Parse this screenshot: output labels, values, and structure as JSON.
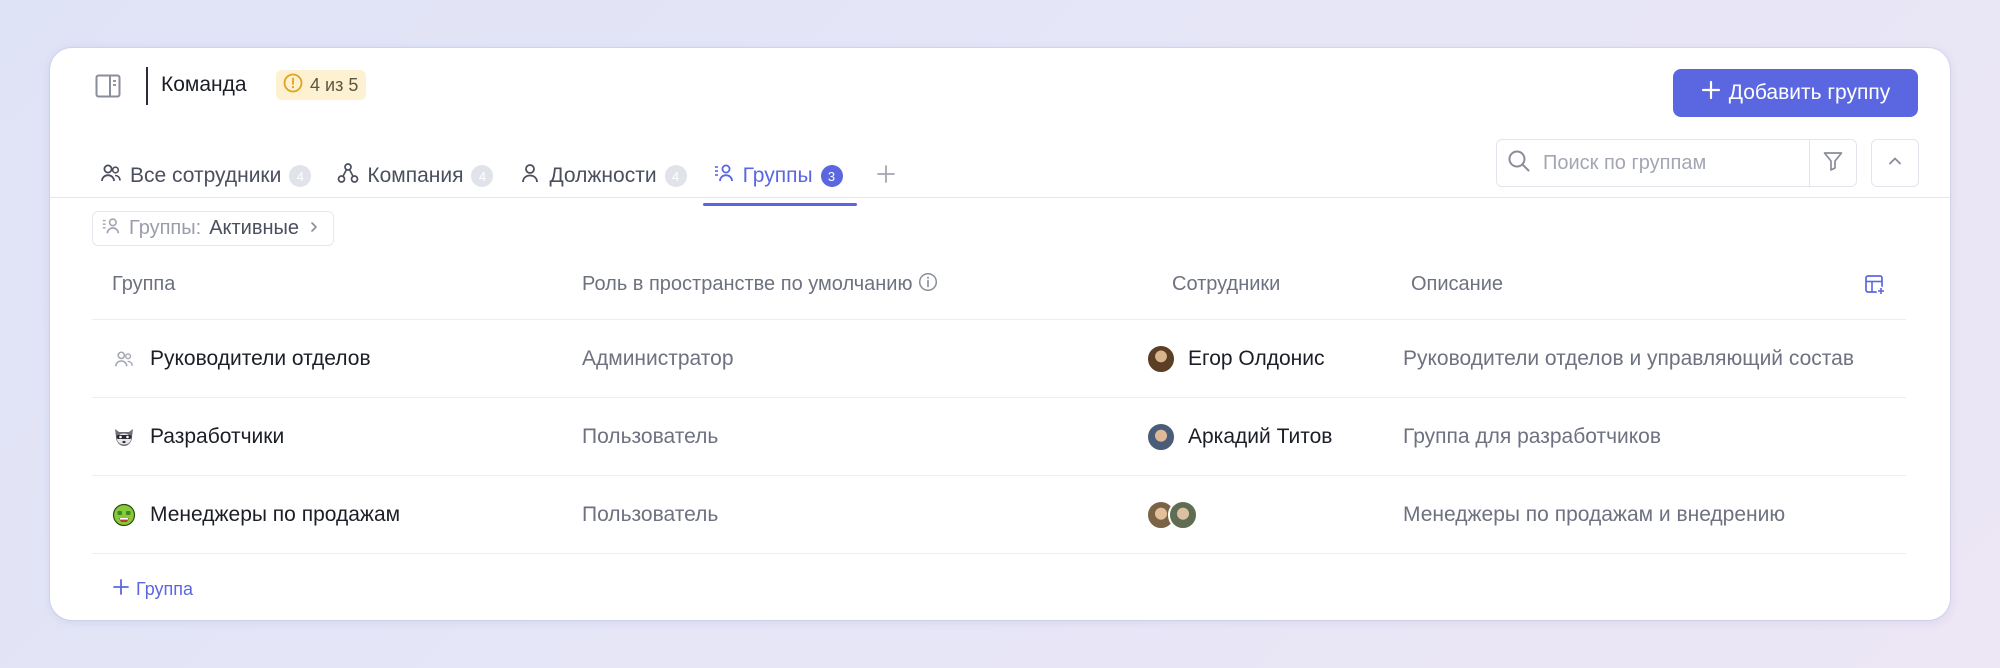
{
  "header": {
    "title": "Команда",
    "limit_badge": "4 из 5",
    "add_button": "Добавить группу"
  },
  "tabs": [
    {
      "label": "Все сотрудники",
      "count": "4",
      "icon": "users-icon"
    },
    {
      "label": "Компания",
      "count": "4",
      "icon": "org-structure-icon"
    },
    {
      "label": "Должности",
      "count": "4",
      "icon": "user-icon"
    },
    {
      "label": "Группы",
      "count": "3",
      "icon": "user-group-icon",
      "active": true
    }
  ],
  "search": {
    "placeholder": "Поиск по группам"
  },
  "filter_chip": {
    "label": "Группы:",
    "value": "Активные"
  },
  "table": {
    "columns": [
      "Группа",
      "Роль в пространстве по умолчанию",
      "Сотрудники",
      "Описание"
    ],
    "rows": [
      {
        "name": "Руководители отделов",
        "icon": "users-icon",
        "role": "Администратор",
        "employee": "Егор Олдонис",
        "avatars": [
          "#7a5a3c"
        ],
        "description": "Руководители отделов и управляющий состав"
      },
      {
        "name": "Разработчики",
        "icon": "raccoon-emoji-icon",
        "role": "Пользователь",
        "employee": "Аркадий Титов",
        "avatars": [
          "#5a6f8a"
        ],
        "description": "Группа для разработчиков"
      },
      {
        "name": "Менеджеры по продажам",
        "icon": "money-face-emoji-icon",
        "role": "Пользователь",
        "employee": "",
        "avatars": [
          "#8a6a4a",
          "#6b7a5a"
        ],
        "description": "Менеджеры по продажам и внедрению"
      }
    ]
  },
  "add_row_label": "Группа",
  "colors": {
    "accent": "#5b67e0",
    "badge_bg": "#fdf1d2",
    "muted_text": "#6e7180"
  }
}
